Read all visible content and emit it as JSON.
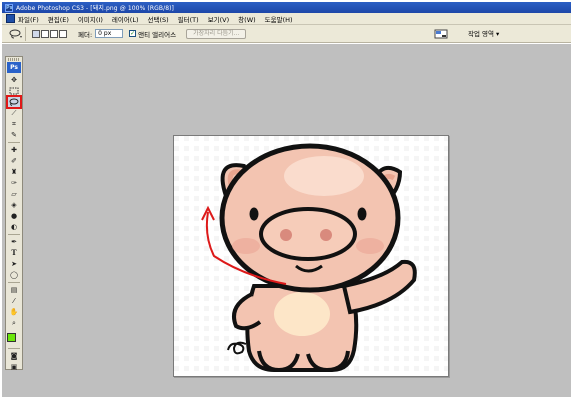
{
  "window": {
    "title": "Adobe Photoshop CS3 - [돼지.png @ 100% (RGB/8)]",
    "app_icon_text": "Ps"
  },
  "menu": {
    "items": [
      "파일(F)",
      "편집(E)",
      "이미지(I)",
      "레이어(L)",
      "선택(S)",
      "필터(T)",
      "보기(V)",
      "창(W)",
      "도움말(H)"
    ]
  },
  "options": {
    "feather_label": "페더:",
    "feather_value": "0 px",
    "antialias_label": "앤티 앨리어스",
    "antialias_checked": true,
    "refine_edge_label": "가장자리 다듬기...",
    "workspace_label": "작업 영역 ▾"
  },
  "toolbox": {
    "logo_text": "Ps",
    "selected_tool": "lasso-tool",
    "foreground_color": "#6be60a",
    "background_color": "#ffffff"
  },
  "colors": {
    "workspace_bg": "#bfbfbf",
    "highlight": "#e01818",
    "pig_skin": "#f3c4b1",
    "pig_belly": "#fde6c8"
  }
}
